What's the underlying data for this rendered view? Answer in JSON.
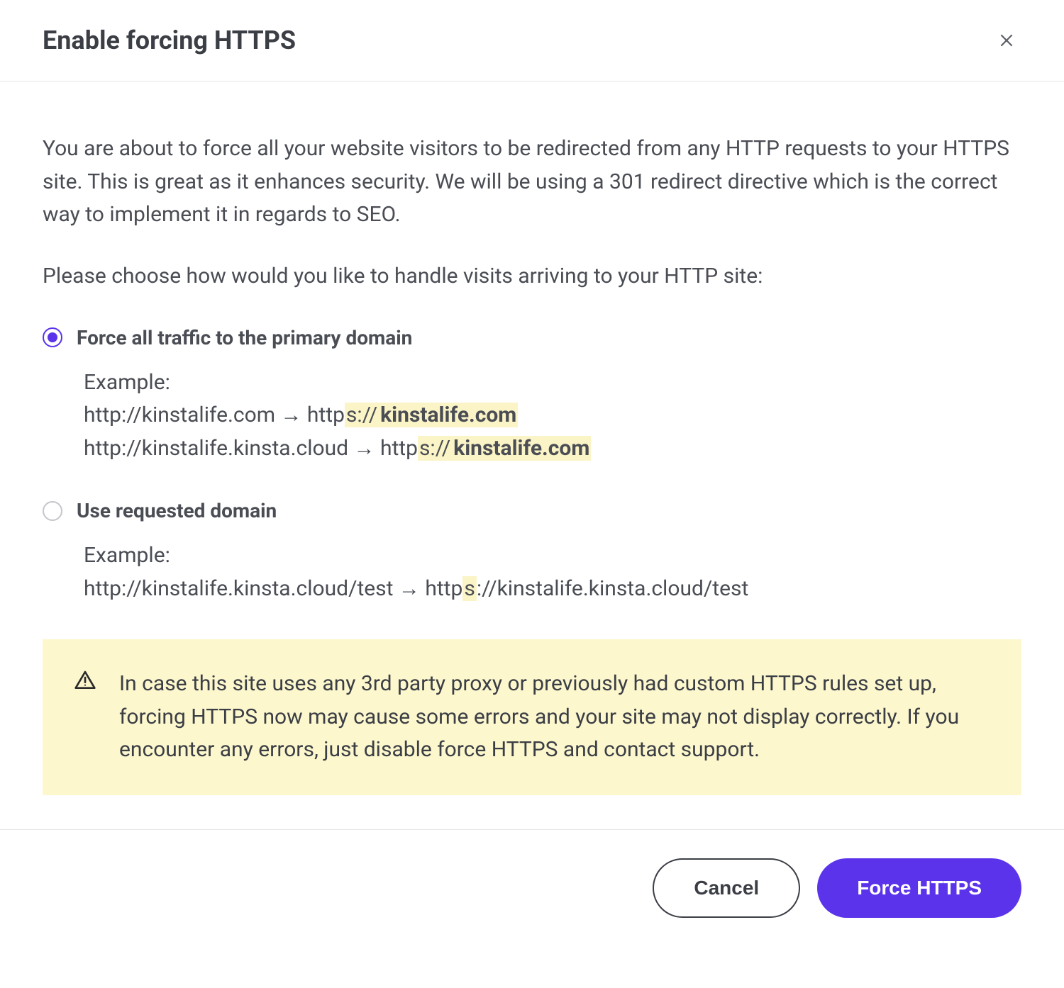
{
  "header": {
    "title": "Enable forcing HTTPS"
  },
  "body": {
    "intro": "You are about to force all your website visitors to be redirected from any HTTP requests to your HTTPS site. This is great as it enhances security. We will be using a 301 redirect directive which is the correct way to implement it in regards to SEO.",
    "prompt": "Please choose how would you like to handle visits arriving to your HTTP site:"
  },
  "options": {
    "primary": {
      "label": "Force all traffic to the primary domain",
      "example_label": "Example:",
      "line1_from": "http://kinstalife.com → http",
      "line1_hl1": "s://",
      "line1_hl2": "kinstalife.com",
      "line2_from": "http://kinstalife.kinsta.cloud → http",
      "line2_hl1": "s://",
      "line2_hl2": "kinstalife.com",
      "selected": true
    },
    "requested": {
      "label": "Use requested domain",
      "example_label": "Example:",
      "line1_from": "http://kinstalife.kinsta.cloud/test → http",
      "line1_hl1": "s",
      "line1_rest": "://kinstalife.kinsta.cloud/test",
      "selected": false
    }
  },
  "warning": {
    "text": "In case this site uses any 3rd party proxy or previously had custom HTTPS rules set up, forcing HTTPS now may cause some errors and your site may not display correctly. If you encounter any errors, just disable force HTTPS and contact support."
  },
  "footer": {
    "cancel_label": "Cancel",
    "confirm_label": "Force HTTPS"
  }
}
